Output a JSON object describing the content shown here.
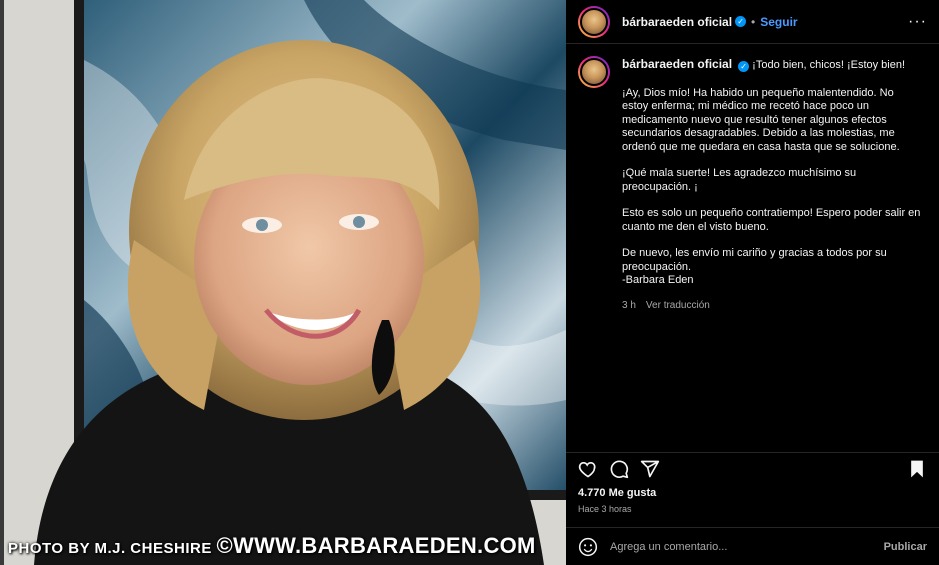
{
  "post": {
    "username": "bárbaraeden oficial",
    "verified_icon": "verified-badge-icon",
    "separator": "•",
    "follow_label": "Seguir",
    "more_icon": "more-options-icon",
    "more_label": "···"
  },
  "photo": {
    "watermark_small": "PHOTO BY M.J. CHESHIRE ",
    "watermark_big": "©WWW.BARBARAEDEN.COM"
  },
  "caption": {
    "username": "bárbaraeden oficial",
    "headline": "¡Todo bien, chicos! ¡Estoy bien!",
    "paragraphs": [
      "¡Ay, Dios mío! Ha habido un pequeño malentendido. No estoy enferma; mi médico me recetó hace poco un medicamento nuevo que resultó tener algunos efectos secundarios desagradables. Debido a las molestias, me ordenó que me quedara en casa hasta que se solucione.",
      "¡Qué mala suerte! Les agradezco muchísimo su preocupación. ¡",
      "Esto es solo un pequeño contratiempo! Espero poder salir en cuanto me den el visto bueno.",
      "De nuevo, les envío mi cariño y gracias a todos por su preocupación.\n-Barbara Eden"
    ],
    "age": "3 h",
    "translate_label": "Ver traducción"
  },
  "actions": {
    "like_icon": "heart-icon",
    "comment_icon": "comment-icon",
    "share_icon": "share-icon",
    "save_icon": "bookmark-icon"
  },
  "stats": {
    "likes": "4.770 Me gusta",
    "posted": "Hace 3 horas"
  },
  "comment_box": {
    "emoji_icon": "emoji-icon",
    "placeholder": "Agrega un comentario...",
    "publish_label": "Publicar"
  }
}
